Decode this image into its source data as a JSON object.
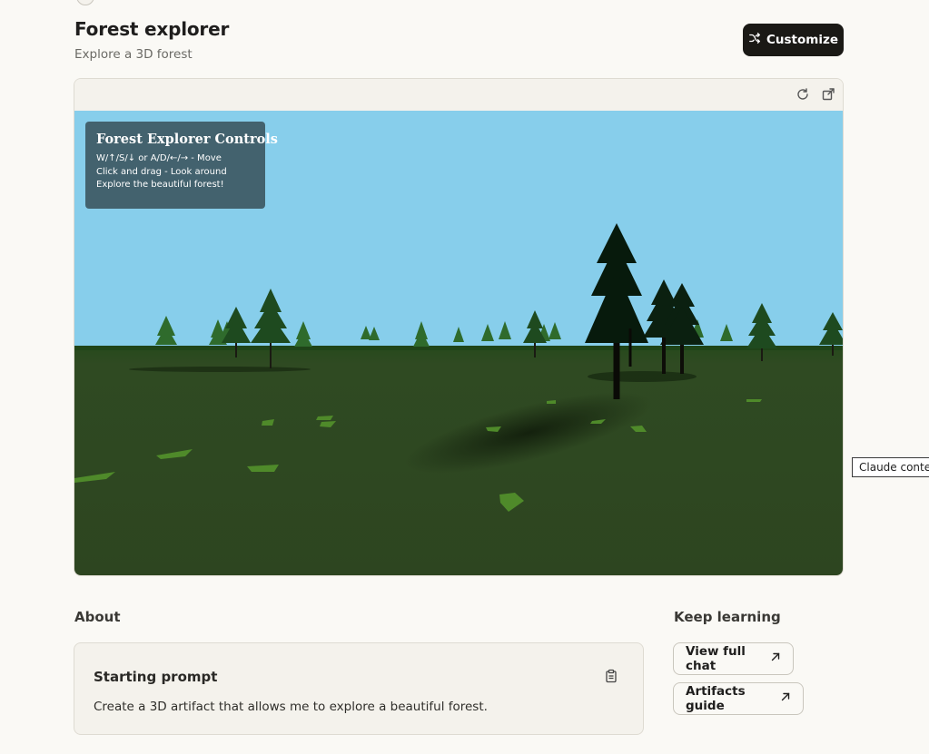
{
  "header": {
    "title": "Forest explorer",
    "subtitle": "Explore a 3D forest",
    "customize_label": "Customize"
  },
  "artifact": {
    "toolbar_icons": [
      "refresh-icon",
      "external-link-icon"
    ],
    "scene": {
      "sky_color": "#87ceeb",
      "ground_color": "#2e4620",
      "tree_color": "#1c4a22"
    },
    "controls_panel": {
      "title": "Forest Explorer Controls",
      "lines": [
        "W/↑/S/↓ or A/D/←/→ - Move",
        "Click and drag - Look around",
        "Explore the beautiful forest!"
      ]
    }
  },
  "tooltip": "Claude content",
  "about": {
    "heading": "About",
    "prompt_title": "Starting prompt",
    "prompt_text": "Create a 3D artifact that allows me to explore a beautiful forest."
  },
  "keep_learning": {
    "heading": "Keep learning",
    "links": [
      {
        "label": "View full chat"
      },
      {
        "label": "Artifacts guide"
      }
    ]
  }
}
